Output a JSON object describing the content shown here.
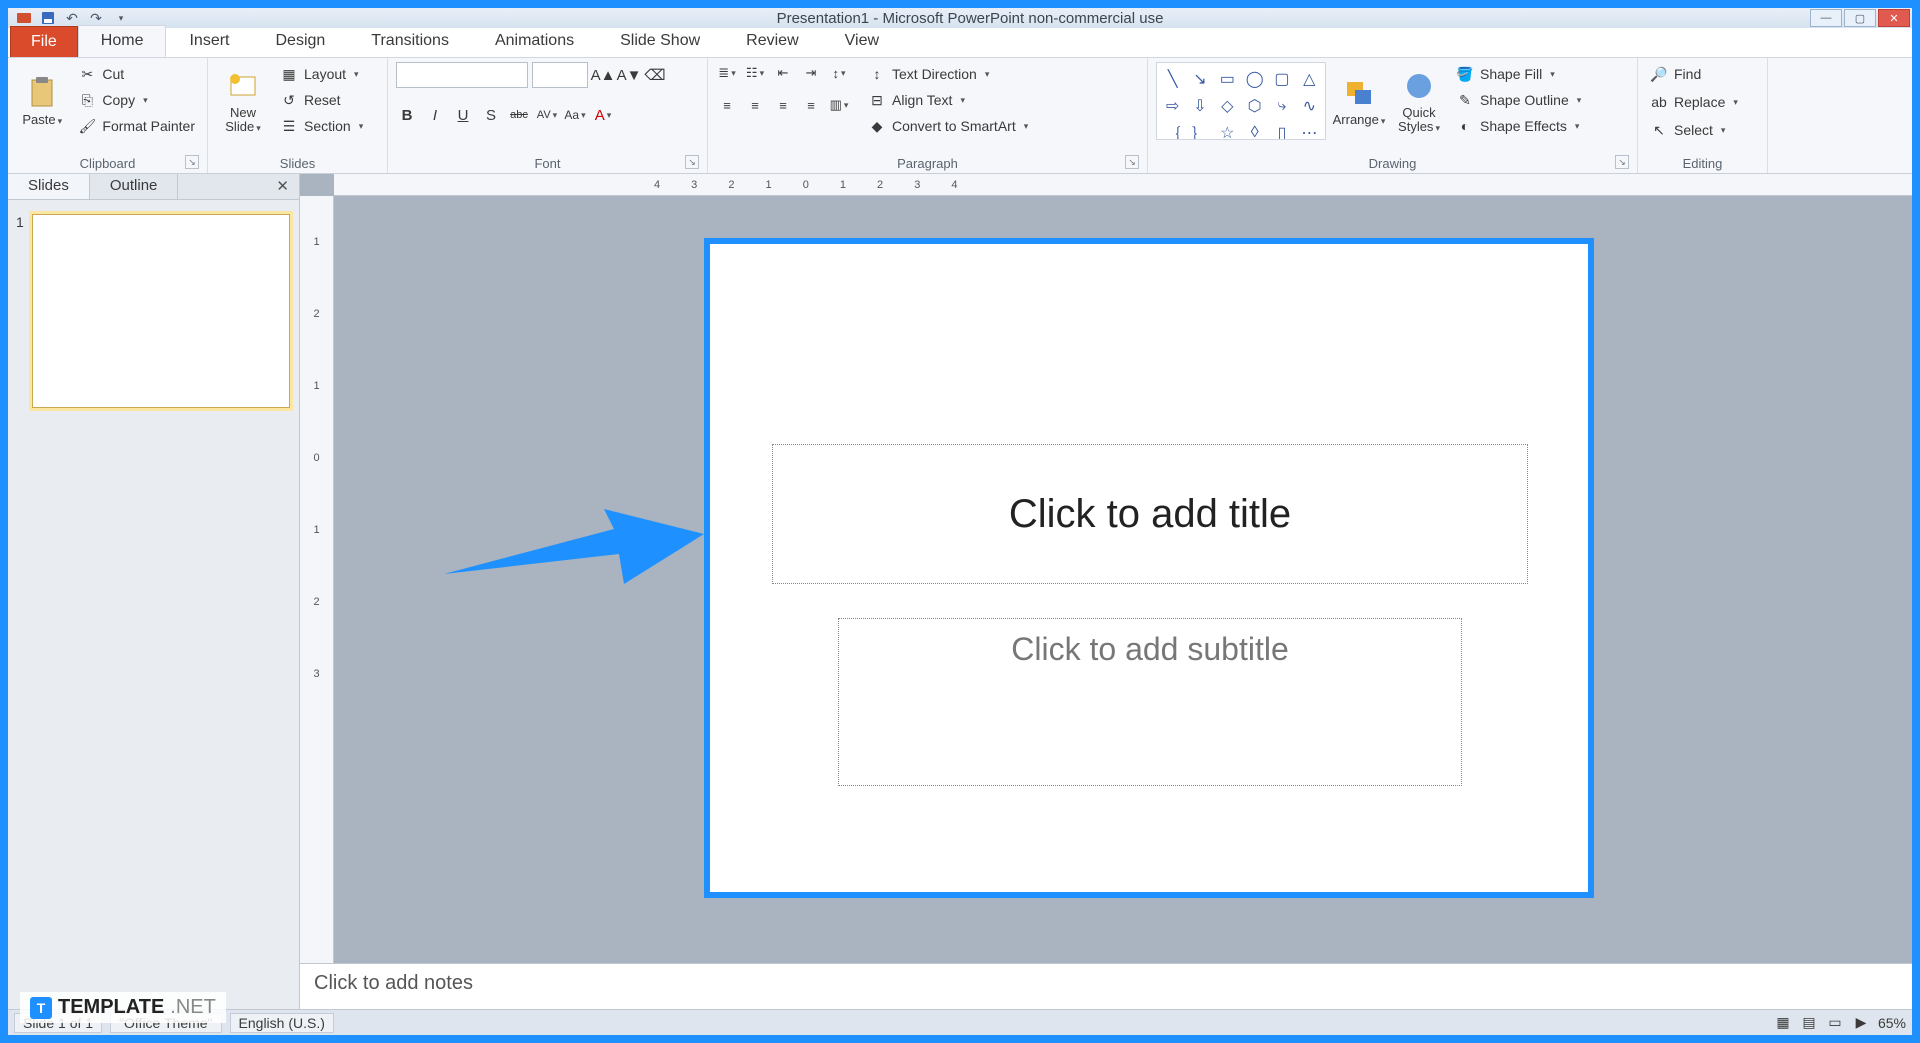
{
  "title": "Presentation1 - Microsoft PowerPoint non-commercial use",
  "tabs": {
    "file": "File",
    "list": [
      "Home",
      "Insert",
      "Design",
      "Transitions",
      "Animations",
      "Slide Show",
      "Review",
      "View"
    ],
    "active": "Home"
  },
  "ribbon": {
    "clipboard": {
      "label": "Clipboard",
      "paste": "Paste",
      "cut": "Cut",
      "copy": "Copy",
      "format_painter": "Format Painter"
    },
    "slides": {
      "label": "Slides",
      "new_slide": "New\nSlide",
      "layout": "Layout",
      "reset": "Reset",
      "section": "Section"
    },
    "font": {
      "label": "Font",
      "btns": [
        "B",
        "I",
        "U",
        "S",
        "abc",
        "AV",
        "Aa",
        "A"
      ]
    },
    "paragraph": {
      "label": "Paragraph",
      "text_direction": "Text Direction",
      "align_text": "Align Text",
      "convert": "Convert to SmartArt"
    },
    "drawing": {
      "label": "Drawing",
      "arrange": "Arrange",
      "quick_styles": "Quick\nStyles",
      "shape_fill": "Shape Fill",
      "shape_outline": "Shape Outline",
      "shape_effects": "Shape Effects"
    },
    "editing": {
      "label": "Editing",
      "find": "Find",
      "replace": "Replace",
      "select": "Select"
    }
  },
  "panel": {
    "tabs": [
      "Slides",
      "Outline"
    ],
    "active": "Slides",
    "slide_number": "1"
  },
  "slide": {
    "title_ph": "Click to add title",
    "subtitle_ph": "Click to add subtitle"
  },
  "notes": {
    "placeholder": "Click to add notes"
  },
  "status": {
    "slide_info": "Slide 1 of 1",
    "theme": "\"Office Theme\"",
    "lang": "English (U.S.)",
    "zoom": "65%"
  },
  "ruler": {
    "h": "4 3 2 1 0 1 2 3 4",
    "v": [
      "1",
      "2",
      "1",
      "0",
      "1",
      "2",
      "3"
    ]
  },
  "watermark": {
    "brand": "TEMPLATE",
    "suffix": ".NET"
  }
}
